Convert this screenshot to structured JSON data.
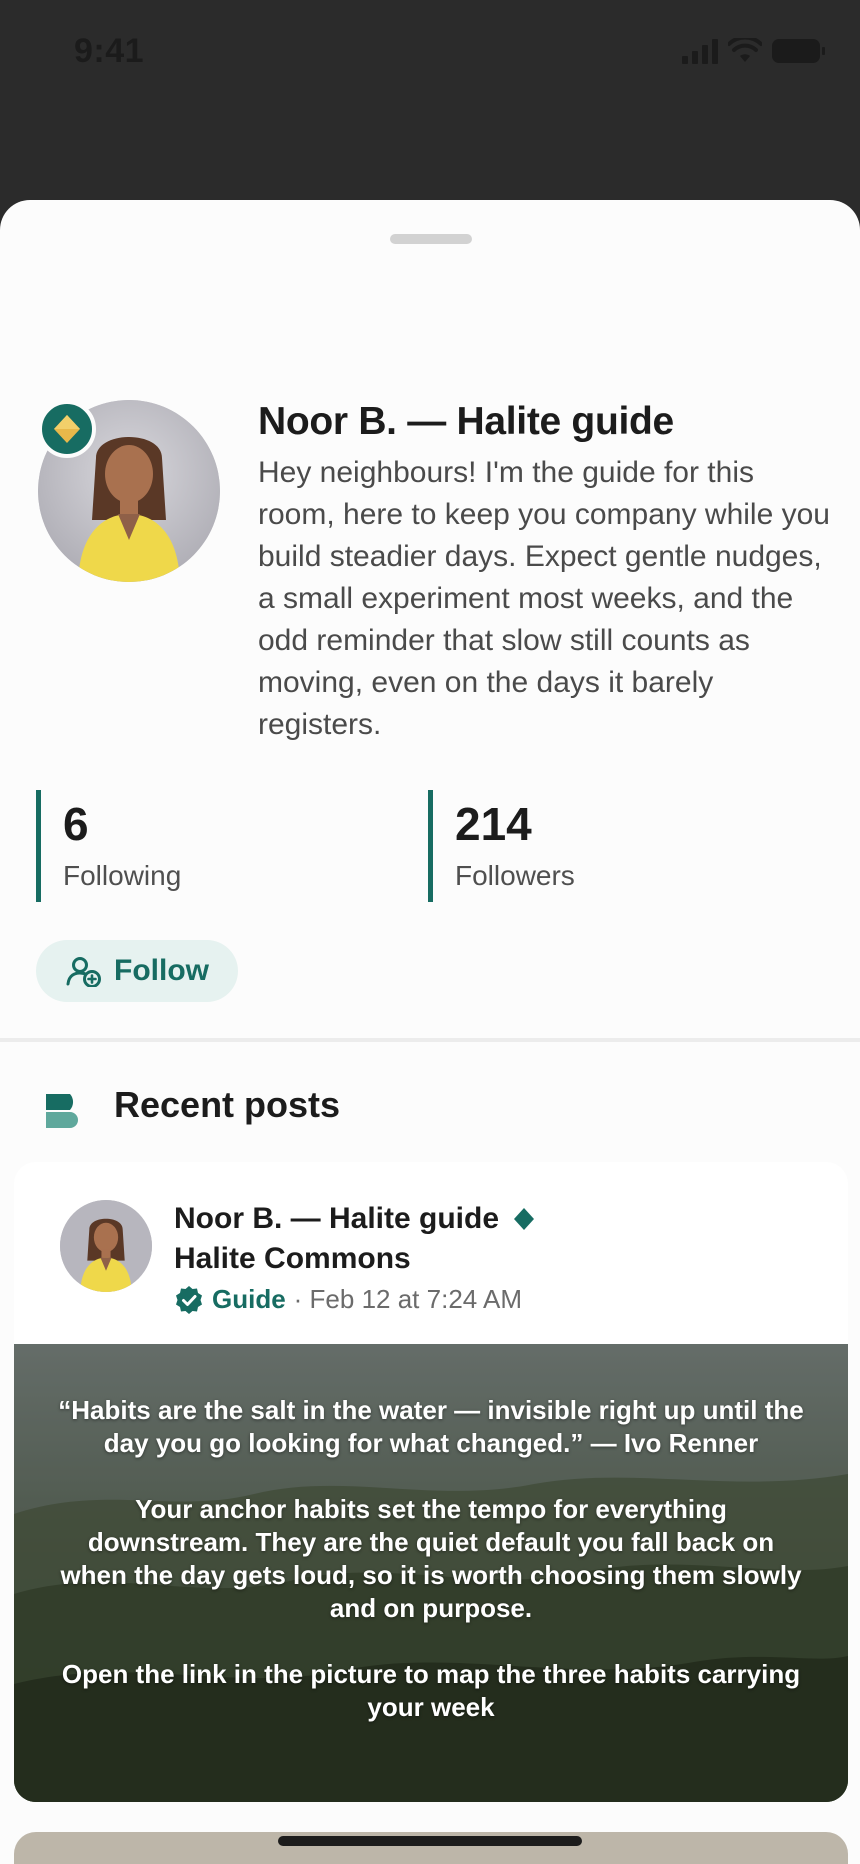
{
  "status_bar": {
    "time": "9:41"
  },
  "profile": {
    "name": "Noor B. — Halite guide",
    "bio": "Hey neighbours! I'm the guide for this room, here to keep you company while you build steadier days. Expect gentle nudges, a small experiment most weeks, and the odd reminder that slow still counts as moving, even on the days it barely registers.",
    "stats": [
      {
        "value": "6",
        "label": "Following"
      },
      {
        "value": "214",
        "label": "Followers"
      }
    ],
    "follow_label": "Follow"
  },
  "section": {
    "title": "Recent posts"
  },
  "post": {
    "author": "Noor B. — Halite guide",
    "community": "Halite Commons",
    "role": "Guide",
    "timestamp": "· Feb 12 at 7:24 AM",
    "image_text": "“Habits are the salt in the water — invisible right up until the day you go looking for what changed.” — Ivo Renner\n\nYour anchor habits set the tempo for everything downstream. They are the quiet default you fall back on when the day gets loud, so it is worth choosing them slowly and on purpose.\n\nOpen the link in the picture to map the three habits carrying your week"
  },
  "colors": {
    "accent": "#176c62",
    "badge_gold": "#e8b84a",
    "follow_bg": "#e6f2f0"
  },
  "icons": [
    "signal-icon",
    "wifi-icon",
    "battery-icon",
    "diamond-badge-icon",
    "person-add-icon",
    "posts-icon",
    "verified-icon"
  ]
}
